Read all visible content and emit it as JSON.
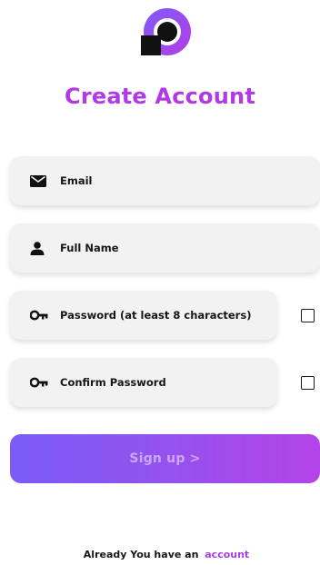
{
  "title": "Create Account",
  "fields": [
    {
      "icon": "envelope-icon",
      "label": "Email"
    },
    {
      "icon": "person-icon",
      "label": "Full Name"
    },
    {
      "icon": "key-icon",
      "label": "Password (at least 8 characters)"
    },
    {
      "icon": "key-icon",
      "label": "Confirm Password"
    }
  ],
  "signup_label": "Sign up >",
  "footer": {
    "text": "Already You have an",
    "link": "account"
  },
  "colors": {
    "accent": "#b13ae6",
    "button_start": "#7a5cf7",
    "button_end": "#b443e9",
    "field_bg": "#f2f2f2"
  }
}
